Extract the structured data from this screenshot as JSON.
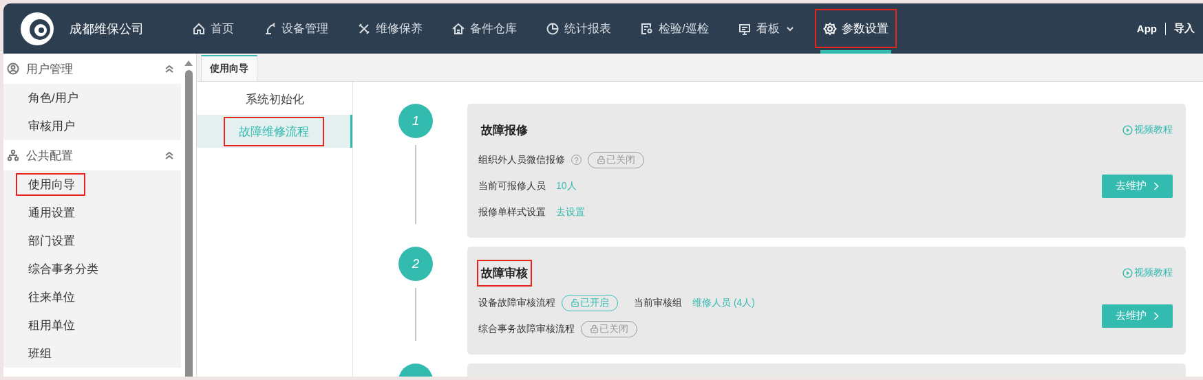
{
  "header": {
    "company": "成都维保公司",
    "nav": [
      {
        "label": "首页",
        "selected": false,
        "marked": false
      },
      {
        "label": "设备管理",
        "selected": false,
        "marked": false
      },
      {
        "label": "维修保养",
        "selected": false,
        "marked": false
      },
      {
        "label": "备件仓库",
        "selected": false,
        "marked": false
      },
      {
        "label": "统计报表",
        "selected": false,
        "marked": false
      },
      {
        "label": "检验/巡检",
        "selected": false,
        "marked": false
      },
      {
        "label": "看板",
        "selected": false,
        "marked": false,
        "dropdown": true
      },
      {
        "label": "参数设置",
        "selected": true,
        "marked": true
      }
    ],
    "right": [
      "App",
      "导入"
    ]
  },
  "sidebar": {
    "groups": [
      {
        "title": "用户管理",
        "expanded": true,
        "items": [
          {
            "label": "角色/用户",
            "marked": false
          },
          {
            "label": "审核用户",
            "marked": false
          }
        ]
      },
      {
        "title": "公共配置",
        "expanded": true,
        "items": [
          {
            "label": "使用向导",
            "marked": true
          },
          {
            "label": "通用设置",
            "marked": false
          },
          {
            "label": "部门设置",
            "marked": false
          },
          {
            "label": "综合事务分类",
            "marked": false
          },
          {
            "label": "往来单位",
            "marked": false
          },
          {
            "label": "租用单位",
            "marked": false
          },
          {
            "label": "班组",
            "marked": false
          }
        ]
      }
    ]
  },
  "tabs": [
    {
      "label": "使用向导",
      "selected": true
    }
  ],
  "subnav": [
    {
      "label": "系统初始化",
      "selected": false,
      "marked": false
    },
    {
      "label": "故障维修流程",
      "selected": true,
      "marked": true
    }
  ],
  "steps": [
    {
      "number": "1",
      "title": "故障报修",
      "title_marked": false,
      "video_link": "视频教程",
      "button": "去维护",
      "rows": [
        [
          {
            "kind": "label",
            "text": "组织外人员微信报修"
          },
          {
            "kind": "help",
            "text": "?"
          },
          {
            "kind": "toggle",
            "on": false,
            "text": "已关闭"
          }
        ],
        [
          {
            "kind": "label",
            "text": "当前可报修人员"
          },
          {
            "kind": "link",
            "text": "10人"
          }
        ],
        [
          {
            "kind": "label",
            "text": "报修单样式设置"
          },
          {
            "kind": "link",
            "text": "去设置"
          }
        ]
      ]
    },
    {
      "number": "2",
      "title": "故障审核",
      "title_marked": true,
      "video_link": "视频教程",
      "button": "去维护",
      "rows": [
        [
          {
            "kind": "label",
            "text": "设备故障审核流程"
          },
          {
            "kind": "toggle",
            "on": true,
            "text": "已开启"
          },
          {
            "kind": "label",
            "text": "当前审核组"
          },
          {
            "kind": "link",
            "text": "维修人员 (4人)"
          }
        ],
        [
          {
            "kind": "label",
            "text": "综合事务故障审核流程"
          },
          {
            "kind": "toggle",
            "on": false,
            "text": "已关闭"
          }
        ]
      ]
    },
    {
      "cut_off": true
    }
  ]
}
